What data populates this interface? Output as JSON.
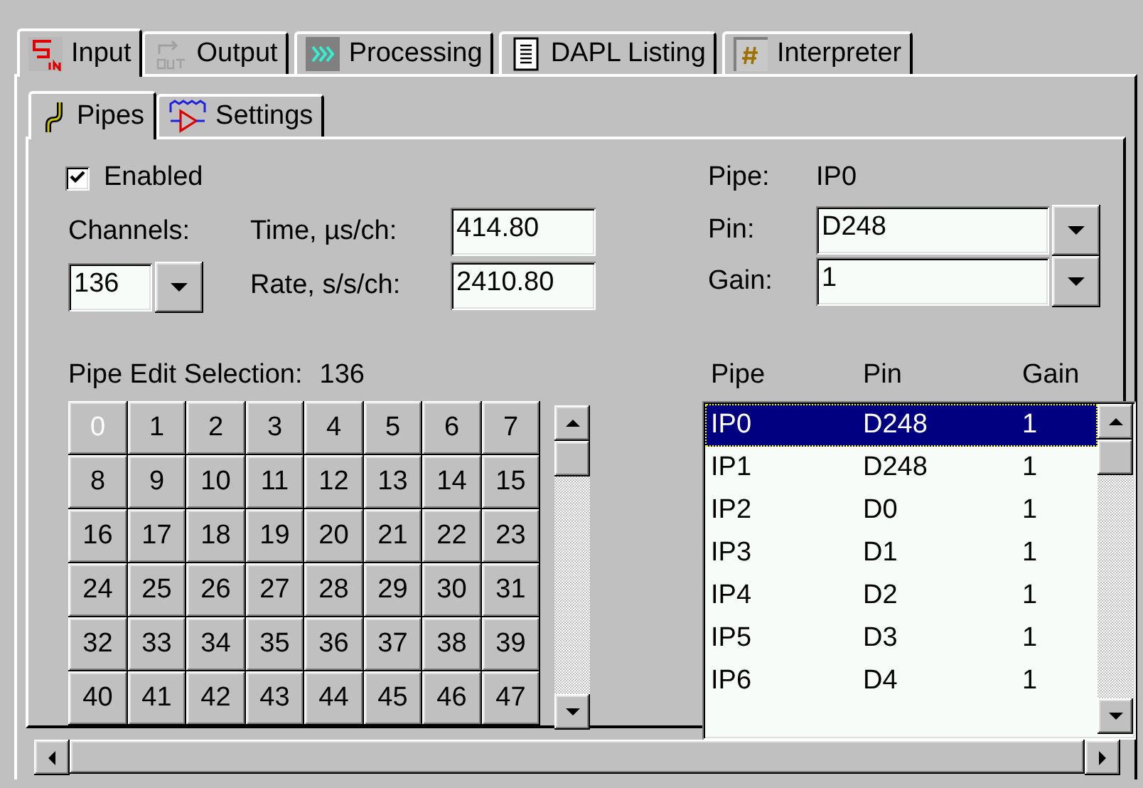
{
  "tabs": [
    {
      "label": "Input",
      "selected": true,
      "kind": "input"
    },
    {
      "label": "Output",
      "selected": false,
      "kind": "output"
    },
    {
      "label": "Processing",
      "selected": false,
      "kind": "processing"
    },
    {
      "label": "DAPL Listing",
      "selected": false,
      "kind": "listing"
    },
    {
      "label": "Interpreter",
      "selected": false,
      "kind": "interpreter"
    }
  ],
  "subtabs": [
    {
      "label": "Pipes",
      "selected": true,
      "kind": "pipes"
    },
    {
      "label": "Settings",
      "selected": false,
      "kind": "settings"
    }
  ],
  "enabled": {
    "label": "Enabled",
    "checked": true
  },
  "channels": {
    "label": "Channels:",
    "value": "136"
  },
  "time": {
    "label": "Time, µs/ch:",
    "value": "414.80"
  },
  "rate": {
    "label": "Rate, s/s/ch:",
    "value": "2410.80"
  },
  "pipe": {
    "label": "Pipe:",
    "value": "IP0"
  },
  "pin": {
    "label": "Pin:",
    "value": "D248"
  },
  "gain": {
    "label": "Gain:",
    "value": "1"
  },
  "pipe_edit_selection": {
    "label": "Pipe Edit Selection:",
    "value": "136"
  },
  "grid_cells": [
    {
      "label": "0",
      "disabled": true
    },
    {
      "label": "1",
      "disabled": false
    },
    {
      "label": "2",
      "disabled": false
    },
    {
      "label": "3",
      "disabled": false
    },
    {
      "label": "4",
      "disabled": false
    },
    {
      "label": "5",
      "disabled": false
    },
    {
      "label": "6",
      "disabled": false
    },
    {
      "label": "7",
      "disabled": false
    },
    {
      "label": "8",
      "disabled": false
    },
    {
      "label": "9",
      "disabled": false
    },
    {
      "label": "10",
      "disabled": false
    },
    {
      "label": "11",
      "disabled": false
    },
    {
      "label": "12",
      "disabled": false
    },
    {
      "label": "13",
      "disabled": false
    },
    {
      "label": "14",
      "disabled": false
    },
    {
      "label": "15",
      "disabled": false
    },
    {
      "label": "16",
      "disabled": false
    },
    {
      "label": "17",
      "disabled": false
    },
    {
      "label": "18",
      "disabled": false
    },
    {
      "label": "19",
      "disabled": false
    },
    {
      "label": "20",
      "disabled": false
    },
    {
      "label": "21",
      "disabled": false
    },
    {
      "label": "22",
      "disabled": false
    },
    {
      "label": "23",
      "disabled": false
    },
    {
      "label": "24",
      "disabled": false
    },
    {
      "label": "25",
      "disabled": false
    },
    {
      "label": "26",
      "disabled": false
    },
    {
      "label": "27",
      "disabled": false
    },
    {
      "label": "28",
      "disabled": false
    },
    {
      "label": "29",
      "disabled": false
    },
    {
      "label": "30",
      "disabled": false
    },
    {
      "label": "31",
      "disabled": false
    },
    {
      "label": "32",
      "disabled": false
    },
    {
      "label": "33",
      "disabled": false
    },
    {
      "label": "34",
      "disabled": false
    },
    {
      "label": "35",
      "disabled": false
    },
    {
      "label": "36",
      "disabled": false
    },
    {
      "label": "37",
      "disabled": false
    },
    {
      "label": "38",
      "disabled": false
    },
    {
      "label": "39",
      "disabled": false
    },
    {
      "label": "40",
      "disabled": false
    },
    {
      "label": "41",
      "disabled": false
    },
    {
      "label": "42",
      "disabled": false
    },
    {
      "label": "43",
      "disabled": false
    },
    {
      "label": "44",
      "disabled": false
    },
    {
      "label": "45",
      "disabled": false
    },
    {
      "label": "46",
      "disabled": false
    },
    {
      "label": "47",
      "disabled": false
    }
  ],
  "pipe_table": {
    "columns": [
      "Pipe",
      "Pin",
      "Gain"
    ],
    "rows": [
      {
        "pipe": "IP0",
        "pin": "D248",
        "gain": "1",
        "selected": true
      },
      {
        "pipe": "IP1",
        "pin": "D248",
        "gain": "1",
        "selected": false
      },
      {
        "pipe": "IP2",
        "pin": "D0",
        "gain": "1",
        "selected": false
      },
      {
        "pipe": "IP3",
        "pin": "D1",
        "gain": "1",
        "selected": false
      },
      {
        "pipe": "IP4",
        "pin": "D2",
        "gain": "1",
        "selected": false
      },
      {
        "pipe": "IP5",
        "pin": "D3",
        "gain": "1",
        "selected": false
      },
      {
        "pipe": "IP6",
        "pin": "D4",
        "gain": "1",
        "selected": false
      }
    ]
  }
}
